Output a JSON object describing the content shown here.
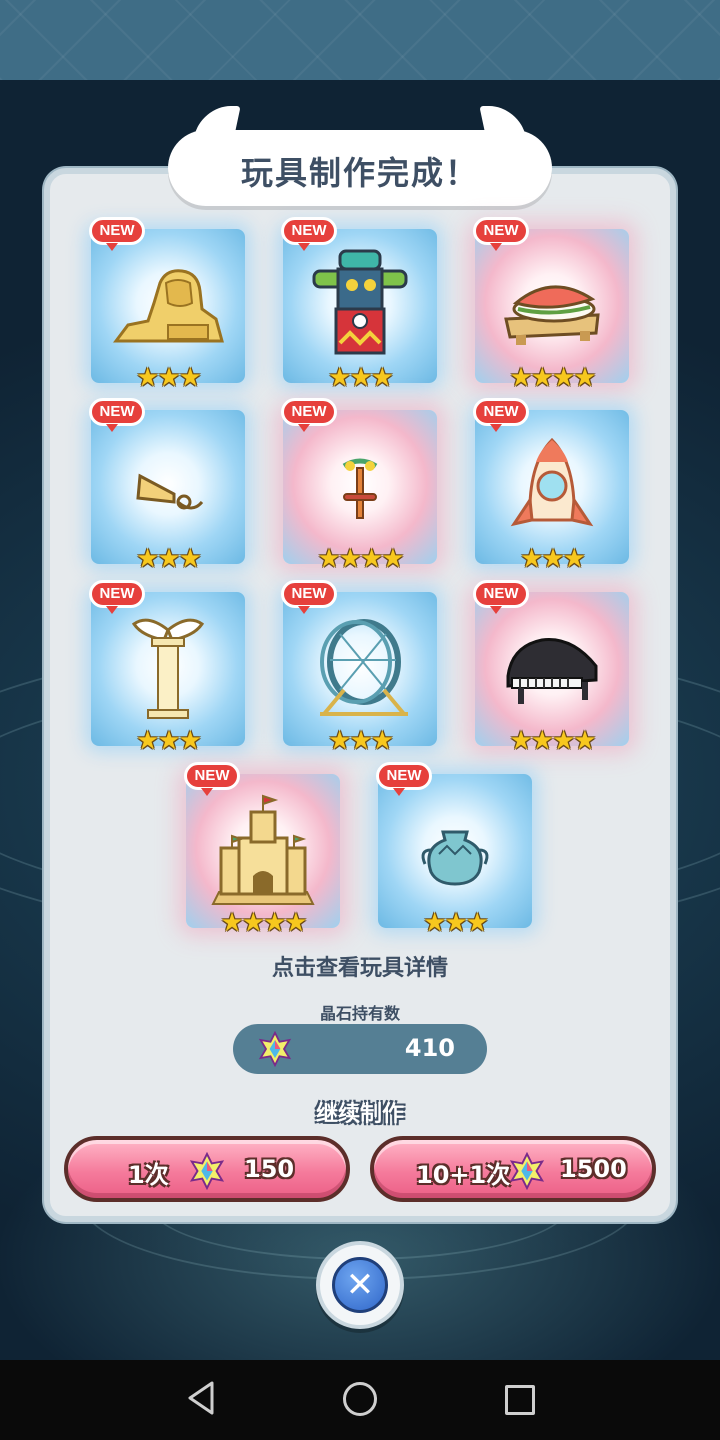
{
  "dialog": {
    "title": "玩具制作完成！",
    "tap_hint": "点击查看玩具详情",
    "crystal_label": "晶石持有数",
    "crystal_count": "410",
    "continue_label": "继续制作"
  },
  "toys": [
    {
      "id": "sphinx",
      "badge": "NEW",
      "stars": "★★★",
      "rarity": "blue",
      "icon": "sphinx-icon"
    },
    {
      "id": "totem",
      "badge": "NEW",
      "stars": "★★★",
      "rarity": "blue",
      "icon": "totem-pole-icon"
    },
    {
      "id": "sushi",
      "badge": "NEW",
      "stars": "★★★★",
      "rarity": "pink",
      "icon": "sushi-icon"
    },
    {
      "id": "horn",
      "badge": "NEW",
      "stars": "★★★",
      "rarity": "blue",
      "icon": "horn-icon"
    },
    {
      "id": "propeller",
      "badge": "NEW",
      "stars": "★★★★",
      "rarity": "pink",
      "icon": "propeller-toy-icon"
    },
    {
      "id": "rocket",
      "badge": "NEW",
      "stars": "★★★",
      "rarity": "blue",
      "icon": "rocket-icon"
    },
    {
      "id": "pillar",
      "badge": "NEW",
      "stars": "★★★",
      "rarity": "blue",
      "icon": "winged-pillar-icon"
    },
    {
      "id": "wheel",
      "badge": "NEW",
      "stars": "★★★",
      "rarity": "blue",
      "icon": "hamster-wheel-icon"
    },
    {
      "id": "piano",
      "badge": "NEW",
      "stars": "★★★★",
      "rarity": "pink",
      "icon": "piano-icon"
    },
    {
      "id": "castle",
      "badge": "NEW",
      "stars": "★★★★",
      "rarity": "pink",
      "icon": "sand-castle-icon"
    },
    {
      "id": "vase",
      "badge": "NEW",
      "stars": "★★★",
      "rarity": "blue",
      "icon": "vase-icon"
    }
  ],
  "buttons": {
    "craft_once_label": "1次",
    "craft_once_cost": "150",
    "craft_ten_label": "10+1次",
    "craft_ten_cost": "1500"
  },
  "colors": {
    "panel": "#e6eaed",
    "button_pink": "#f57b9c",
    "new_badge": "#e6403c",
    "star": "#f7c81e",
    "text_dark": "#3e4f64"
  }
}
